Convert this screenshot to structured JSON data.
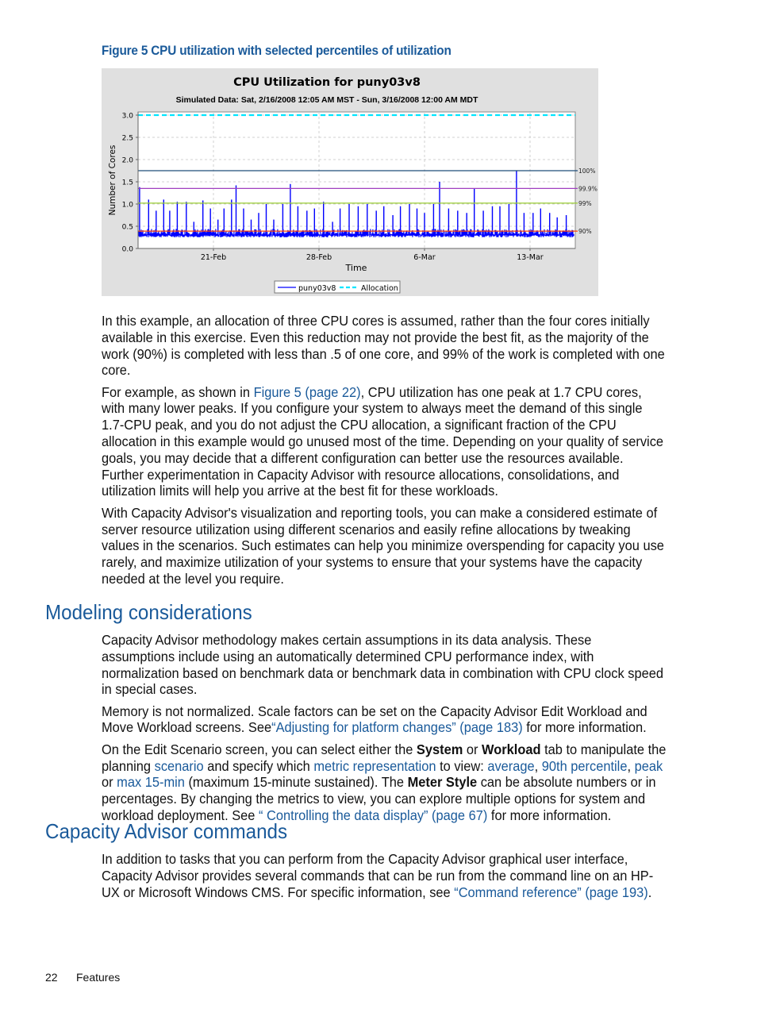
{
  "figure": {
    "caption": "Figure 5  CPU utilization with selected percentiles of utilization"
  },
  "chart_data": {
    "type": "line",
    "title": "CPU Utilization for puny03v8",
    "subtitle": "Simulated Data: Sat, 2/16/2008 12:05 AM MST - Sun, 3/16/2008 12:00 AM MDT",
    "xlabel": "Time",
    "ylabel": "Number of Cores",
    "ylim": [
      0,
      3.0
    ],
    "y_ticks": [
      "0.0",
      "0.5",
      "1.0",
      "1.5",
      "2.0",
      "2.5",
      "3.0"
    ],
    "x_range_days": [
      0,
      29
    ],
    "x_ticks": [
      {
        "label": "21-Feb",
        "day": 5
      },
      {
        "label": "28-Feb",
        "day": 12
      },
      {
        "label": "6-Mar",
        "day": 19
      },
      {
        "label": "13-Mar",
        "day": 26
      }
    ],
    "grid": true,
    "legend": {
      "placement": "bottom",
      "entries": [
        "puny03v8",
        "Allocation"
      ]
    },
    "series": [
      {
        "name": "puny03v8",
        "color": "#0000ff",
        "baseline_range": [
          0.25,
          0.4
        ],
        "peaks": [
          {
            "day": 0.1,
            "value": 1.38
          },
          {
            "day": 0.7,
            "value": 1.1
          },
          {
            "day": 1.2,
            "value": 0.85
          },
          {
            "day": 1.7,
            "value": 1.1
          },
          {
            "day": 2.1,
            "value": 0.85
          },
          {
            "day": 2.6,
            "value": 1.05
          },
          {
            "day": 3.2,
            "value": 1.05
          },
          {
            "day": 3.7,
            "value": 0.6
          },
          {
            "day": 4.3,
            "value": 1.08
          },
          {
            "day": 4.8,
            "value": 0.9
          },
          {
            "day": 5.3,
            "value": 0.65
          },
          {
            "day": 5.7,
            "value": 0.9
          },
          {
            "day": 6.2,
            "value": 1.1
          },
          {
            "day": 6.5,
            "value": 1.42
          },
          {
            "day": 7.0,
            "value": 0.9
          },
          {
            "day": 7.5,
            "value": 0.65
          },
          {
            "day": 8.0,
            "value": 0.8
          },
          {
            "day": 8.5,
            "value": 1.0
          },
          {
            "day": 9.0,
            "value": 0.65
          },
          {
            "day": 9.6,
            "value": 1.0
          },
          {
            "day": 10.1,
            "value": 1.45
          },
          {
            "day": 10.6,
            "value": 0.95
          },
          {
            "day": 11.2,
            "value": 0.85
          },
          {
            "day": 11.7,
            "value": 0.9
          },
          {
            "day": 12.3,
            "value": 1.05
          },
          {
            "day": 12.9,
            "value": 0.6
          },
          {
            "day": 13.4,
            "value": 0.9
          },
          {
            "day": 14.0,
            "value": 1.0
          },
          {
            "day": 14.6,
            "value": 0.95
          },
          {
            "day": 15.2,
            "value": 1.0
          },
          {
            "day": 15.8,
            "value": 0.85
          },
          {
            "day": 16.3,
            "value": 0.95
          },
          {
            "day": 16.9,
            "value": 0.75
          },
          {
            "day": 17.4,
            "value": 0.95
          },
          {
            "day": 18.0,
            "value": 1.0
          },
          {
            "day": 18.5,
            "value": 0.9
          },
          {
            "day": 19.0,
            "value": 0.8
          },
          {
            "day": 19.6,
            "value": 1.0
          },
          {
            "day": 20.0,
            "value": 1.5
          },
          {
            "day": 20.6,
            "value": 0.9
          },
          {
            "day": 21.2,
            "value": 0.85
          },
          {
            "day": 21.8,
            "value": 0.8
          },
          {
            "day": 22.3,
            "value": 1.35
          },
          {
            "day": 22.9,
            "value": 0.85
          },
          {
            "day": 23.5,
            "value": 0.95
          },
          {
            "day": 24.0,
            "value": 0.95
          },
          {
            "day": 24.6,
            "value": 1.0
          },
          {
            "day": 25.1,
            "value": 1.75
          },
          {
            "day": 25.6,
            "value": 0.8
          },
          {
            "day": 26.2,
            "value": 0.8
          },
          {
            "day": 26.7,
            "value": 0.9
          },
          {
            "day": 27.3,
            "value": 0.8
          },
          {
            "day": 27.8,
            "value": 0.7
          },
          {
            "day": 28.4,
            "value": 0.75
          }
        ]
      },
      {
        "name": "Allocation",
        "color": "#00e5ff",
        "style": "dashed",
        "value": 3.0
      }
    ],
    "percentile_lines": [
      {
        "label": "100%",
        "value": 1.75,
        "color": "#1f4e79"
      },
      {
        "label": "99.9%",
        "value": 1.35,
        "color": "#a040c0"
      },
      {
        "label": "99%",
        "value": 1.02,
        "color": "#9acd32"
      },
      {
        "label": "90%",
        "value": 0.39,
        "color": "#ff4000"
      }
    ]
  },
  "paragraphs_intro": [
    "In this example, an allocation of three CPU cores is assumed, rather than the four cores initially available in this exercise. Even this reduction may not provide the best fit, as the majority of the work (90%) is completed with less than .5 of one core, and 99% of the work is completed with one core."
  ],
  "para2": {
    "pre": "For example, as shown in ",
    "link": "Figure 5 (page 22)",
    "post": ", CPU utilization has one peak at 1.7 CPU cores, with many lower peaks. If you configure your system to always meet the demand of this single 1.7-CPU peak, and you do not adjust the CPU allocation, a significant fraction of the CPU allocation in this example would go unused most of the time. Depending on your quality of service goals, you may decide that a different configuration can better use the resources available. Further experimentation in Capacity Advisor with resource allocations, consolidations, and utilization limits will help you arrive at the best fit for these workloads."
  },
  "para3": "With Capacity Advisor's visualization and reporting tools, you can make a considered estimate of server resource utilization using different scenarios and easily refine allocations by tweaking values in the scenarios. Such estimates can help you minimize overspending for capacity you use rarely, and maximize utilization of your systems to ensure that your systems have the capacity needed at the level you require.",
  "section1": {
    "heading": "Modeling considerations",
    "p1": "Capacity Advisor methodology makes certain assumptions in its data analysis. These assumptions include using an automatically determined CPU performance index, with normalization based on benchmark data or benchmark data in combination with CPU clock speed in special cases.",
    "p2": {
      "pre": "Memory is not normalized. Scale factors can be set on the Capacity Advisor Edit Workload and Move Workload screens. See",
      "link": "“Adjusting for platform changes” (page 183)",
      "post": " for more information."
    },
    "p3": {
      "t1": "On the Edit Scenario screen, you can select either the ",
      "b1": "System",
      "t2": " or ",
      "b2": "Workload",
      "t3": " tab to manipulate the planning ",
      "l1": "scenario",
      "t4": " and specify which ",
      "l2": "metric representation",
      "t5": " to view: ",
      "l3": "average",
      "t6": ", ",
      "l4": "90th percentile",
      "t7": ", ",
      "l5": "peak",
      "t8": " or ",
      "l6": "max 15-min",
      "t9": " (maximum 15-minute sustained). The ",
      "b3": "Meter Style",
      "t10": " can be absolute numbers or in percentages. By changing the metrics to view, you can explore multiple options for system and workload deployment. See ",
      "l7": "“ Controlling the data display” (page 67)",
      "t11": " for more information."
    }
  },
  "section2": {
    "heading": "Capacity Advisor commands",
    "p1": {
      "pre": "In addition to tasks that you can perform from the Capacity Advisor graphical user interface, Capacity Advisor provides several commands that can be run from the command line on an HP-UX or Microsoft Windows CMS. For specific information, see ",
      "link": "“Command reference” (page 193)",
      "post": "."
    }
  },
  "footer": {
    "page_number": "22",
    "section": "Features"
  }
}
